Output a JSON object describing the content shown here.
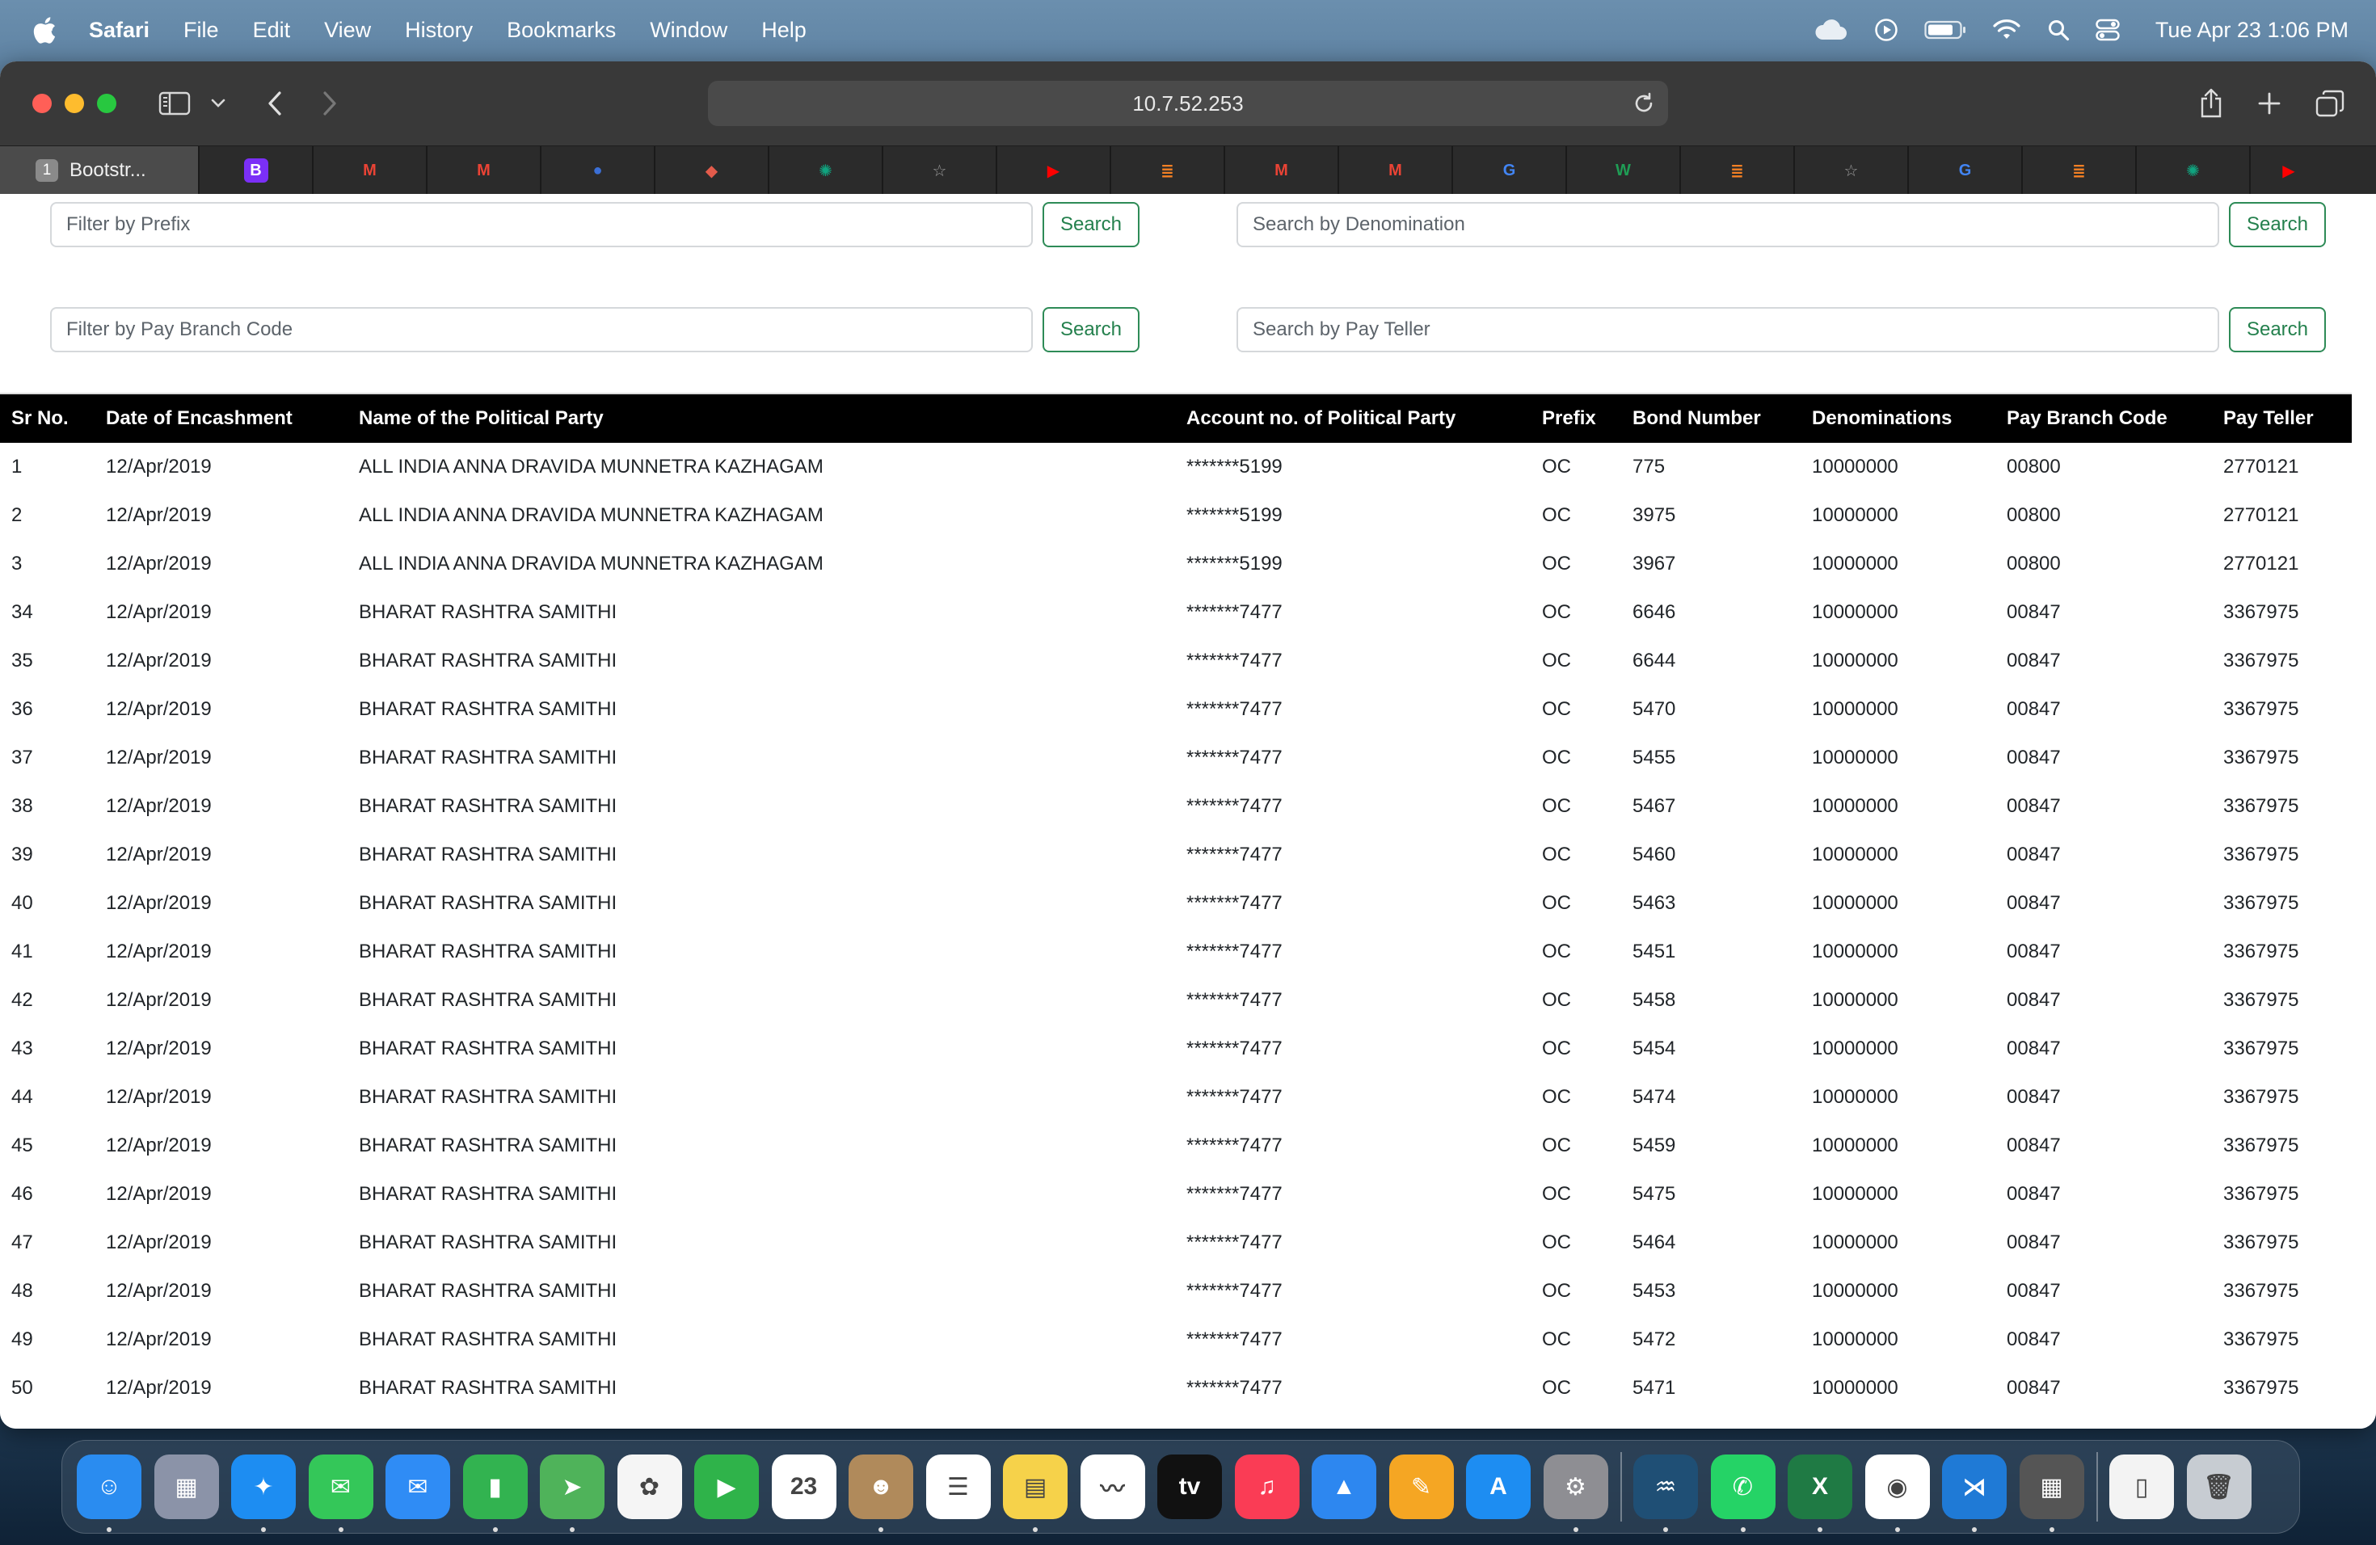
{
  "menubar": {
    "app_name": "Safari",
    "menus": [
      "File",
      "Edit",
      "View",
      "History",
      "Bookmarks",
      "Window",
      "Help"
    ],
    "clock": "Tue Apr 23  1:06 PM",
    "status_icons": [
      "icloud-icon",
      "play-circle-icon",
      "battery-icon",
      "wifi-icon",
      "spotlight-search-icon",
      "control-center-icon"
    ]
  },
  "browser": {
    "address": "10.7.52.253",
    "active_tab": {
      "number": "1",
      "title": "Bootstr..."
    },
    "tabs": [
      {
        "icon": "bootstrap-b",
        "color": "#7b2ff7",
        "glyph": "B"
      },
      {
        "icon": "gmail",
        "color": "#ea4335",
        "glyph": "M"
      },
      {
        "icon": "gmail",
        "color": "#ea4335",
        "glyph": "M"
      },
      {
        "icon": "contacts",
        "color": "#3b6fd6",
        "glyph": "●"
      },
      {
        "icon": "cube",
        "color": "#e35b4b",
        "glyph": "◆"
      },
      {
        "icon": "chatgpt",
        "color": "#10a37f",
        "glyph": "✺"
      },
      {
        "icon": "star",
        "color": "#9a9a9a",
        "glyph": "☆"
      },
      {
        "icon": "youtube",
        "color": "#ff0000",
        "glyph": "▶"
      },
      {
        "icon": "stackoverflow",
        "color": "#f48024",
        "glyph": "≣"
      },
      {
        "icon": "gmail",
        "color": "#ea4335",
        "glyph": "M"
      },
      {
        "icon": "gmail",
        "color": "#ea4335",
        "glyph": "M"
      },
      {
        "icon": "google",
        "color": "#4285f4",
        "glyph": "G"
      },
      {
        "icon": "w-site",
        "color": "#1f9d55",
        "glyph": "W"
      },
      {
        "icon": "stackoverflow",
        "color": "#f48024",
        "glyph": "≣"
      },
      {
        "icon": "star",
        "color": "#9a9a9a",
        "glyph": "☆"
      },
      {
        "icon": "google",
        "color": "#4285f4",
        "glyph": "G"
      },
      {
        "icon": "stackoverflow",
        "color": "#f48024",
        "glyph": "≣"
      },
      {
        "icon": "chatgpt",
        "color": "#10a37f",
        "glyph": "✺"
      },
      {
        "icon": "youtube",
        "color": "#ff0000",
        "glyph": "▶"
      }
    ]
  },
  "filters": {
    "prefix_placeholder": "Filter by Prefix",
    "denomination_placeholder": "Search by Denomination",
    "branch_placeholder": "Filter by Pay Branch Code",
    "teller_placeholder": "Search by Pay Teller",
    "search_label": "Search"
  },
  "table": {
    "headers": [
      "Sr No.",
      "Date of Encashment",
      "Name of the Political Party",
      "Account no. of Political Party",
      "Prefix",
      "Bond Number",
      "Denominations",
      "Pay Branch Code",
      "Pay Teller"
    ],
    "rows": [
      [
        "1",
        "12/Apr/2019",
        "ALL INDIA ANNA DRAVIDA MUNNETRA KAZHAGAM",
        "*******5199",
        "OC",
        "775",
        "10000000",
        "00800",
        "2770121"
      ],
      [
        "2",
        "12/Apr/2019",
        "ALL INDIA ANNA DRAVIDA MUNNETRA KAZHAGAM",
        "*******5199",
        "OC",
        "3975",
        "10000000",
        "00800",
        "2770121"
      ],
      [
        "3",
        "12/Apr/2019",
        "ALL INDIA ANNA DRAVIDA MUNNETRA KAZHAGAM",
        "*******5199",
        "OC",
        "3967",
        "10000000",
        "00800",
        "2770121"
      ],
      [
        "34",
        "12/Apr/2019",
        "BHARAT RASHTRA SAMITHI",
        "*******7477",
        "OC",
        "6646",
        "10000000",
        "00847",
        "3367975"
      ],
      [
        "35",
        "12/Apr/2019",
        "BHARAT RASHTRA SAMITHI",
        "*******7477",
        "OC",
        "6644",
        "10000000",
        "00847",
        "3367975"
      ],
      [
        "36",
        "12/Apr/2019",
        "BHARAT RASHTRA SAMITHI",
        "*******7477",
        "OC",
        "5470",
        "10000000",
        "00847",
        "3367975"
      ],
      [
        "37",
        "12/Apr/2019",
        "BHARAT RASHTRA SAMITHI",
        "*******7477",
        "OC",
        "5455",
        "10000000",
        "00847",
        "3367975"
      ],
      [
        "38",
        "12/Apr/2019",
        "BHARAT RASHTRA SAMITHI",
        "*******7477",
        "OC",
        "5467",
        "10000000",
        "00847",
        "3367975"
      ],
      [
        "39",
        "12/Apr/2019",
        "BHARAT RASHTRA SAMITHI",
        "*******7477",
        "OC",
        "5460",
        "10000000",
        "00847",
        "3367975"
      ],
      [
        "40",
        "12/Apr/2019",
        "BHARAT RASHTRA SAMITHI",
        "*******7477",
        "OC",
        "5463",
        "10000000",
        "00847",
        "3367975"
      ],
      [
        "41",
        "12/Apr/2019",
        "BHARAT RASHTRA SAMITHI",
        "*******7477",
        "OC",
        "5451",
        "10000000",
        "00847",
        "3367975"
      ],
      [
        "42",
        "12/Apr/2019",
        "BHARAT RASHTRA SAMITHI",
        "*******7477",
        "OC",
        "5458",
        "10000000",
        "00847",
        "3367975"
      ],
      [
        "43",
        "12/Apr/2019",
        "BHARAT RASHTRA SAMITHI",
        "*******7477",
        "OC",
        "5454",
        "10000000",
        "00847",
        "3367975"
      ],
      [
        "44",
        "12/Apr/2019",
        "BHARAT RASHTRA SAMITHI",
        "*******7477",
        "OC",
        "5474",
        "10000000",
        "00847",
        "3367975"
      ],
      [
        "45",
        "12/Apr/2019",
        "BHARAT RASHTRA SAMITHI",
        "*******7477",
        "OC",
        "5459",
        "10000000",
        "00847",
        "3367975"
      ],
      [
        "46",
        "12/Apr/2019",
        "BHARAT RASHTRA SAMITHI",
        "*******7477",
        "OC",
        "5475",
        "10000000",
        "00847",
        "3367975"
      ],
      [
        "47",
        "12/Apr/2019",
        "BHARAT RASHTRA SAMITHI",
        "*******7477",
        "OC",
        "5464",
        "10000000",
        "00847",
        "3367975"
      ],
      [
        "48",
        "12/Apr/2019",
        "BHARAT RASHTRA SAMITHI",
        "*******7477",
        "OC",
        "5453",
        "10000000",
        "00847",
        "3367975"
      ],
      [
        "49",
        "12/Apr/2019",
        "BHARAT RASHTRA SAMITHI",
        "*******7477",
        "OC",
        "5472",
        "10000000",
        "00847",
        "3367975"
      ],
      [
        "50",
        "12/Apr/2019",
        "BHARAT RASHTRA SAMITHI",
        "*******7477",
        "OC",
        "5471",
        "10000000",
        "00847",
        "3367975"
      ]
    ]
  },
  "dock": {
    "apps": [
      {
        "name": "finder",
        "color": "#2a8cf0",
        "glyph": "☺",
        "running": true
      },
      {
        "name": "launchpad",
        "color": "#8b93a8",
        "glyph": "▦",
        "running": false
      },
      {
        "name": "safari",
        "color": "#1d8df2",
        "glyph": "✦",
        "running": true
      },
      {
        "name": "messages",
        "color": "#34c759",
        "glyph": "✉",
        "running": true
      },
      {
        "name": "mail",
        "color": "#2f8cf5",
        "glyph": "✉",
        "running": false
      },
      {
        "name": "numbers",
        "color": "#32b350",
        "glyph": "▮",
        "running": true
      },
      {
        "name": "maps",
        "color": "#4fb35a",
        "glyph": "➤",
        "running": true
      },
      {
        "name": "photos",
        "color": "#f5f5f5",
        "glyph": "✿",
        "running": false
      },
      {
        "name": "facetime",
        "color": "#2fb34a",
        "glyph": "▶",
        "running": false
      },
      {
        "name": "calendar",
        "color": "#ffffff",
        "glyph": "23",
        "running": false
      },
      {
        "name": "contacts",
        "color": "#b08a5b",
        "glyph": "☻",
        "running": true
      },
      {
        "name": "reminders",
        "color": "#ffffff",
        "glyph": "☰",
        "running": false
      },
      {
        "name": "notes",
        "color": "#f6d24a",
        "glyph": "▤",
        "running": true
      },
      {
        "name": "freeform",
        "color": "#ffffff",
        "glyph": "〰",
        "running": false
      },
      {
        "name": "apple-tv",
        "color": "#111111",
        "glyph": "tv",
        "running": false
      },
      {
        "name": "music",
        "color": "#fa3c55",
        "glyph": "♫",
        "running": false
      },
      {
        "name": "keynote",
        "color": "#2d87f0",
        "glyph": "▲",
        "running": false
      },
      {
        "name": "pages",
        "color": "#f5a623",
        "glyph": "✎",
        "running": false
      },
      {
        "name": "app-store",
        "color": "#1d8df2",
        "glyph": "A",
        "running": false
      },
      {
        "name": "system-settings",
        "color": "#8e8e93",
        "glyph": "⚙",
        "running": true
      },
      {
        "name": "mysql-workbench",
        "color": "#1f4f75",
        "glyph": "♒",
        "running": true
      },
      {
        "name": "whatsapp",
        "color": "#25d366",
        "glyph": "✆",
        "running": true
      },
      {
        "name": "excel",
        "color": "#1f7a44",
        "glyph": "X",
        "running": true
      },
      {
        "name": "chrome",
        "color": "#ffffff",
        "glyph": "◉",
        "running": true
      },
      {
        "name": "vscode",
        "color": "#1f7ad6",
        "glyph": "⋊",
        "running": true
      },
      {
        "name": "calculator",
        "color": "#555555",
        "glyph": "▦",
        "running": true
      },
      {
        "name": "documents",
        "color": "#f3f3f3",
        "glyph": "▯",
        "running": false
      },
      {
        "name": "trash",
        "color": "#c7ccd2",
        "glyph": "🗑",
        "running": false
      }
    ]
  }
}
